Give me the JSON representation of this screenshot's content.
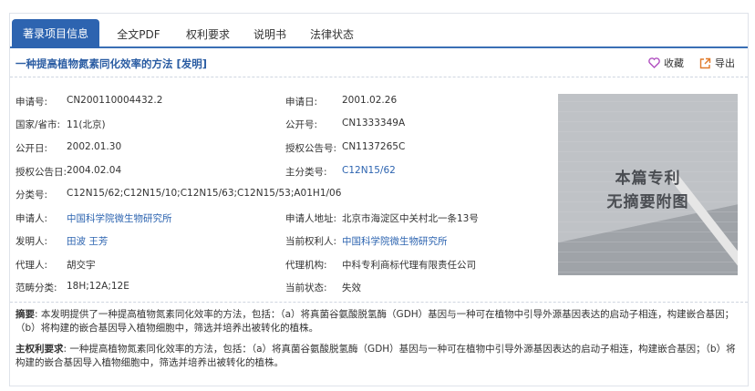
{
  "tabs": [
    {
      "label": "著录项目信息",
      "active": true
    },
    {
      "label": "全文PDF"
    },
    {
      "label": "权利要求"
    },
    {
      "label": "说明书"
    },
    {
      "label": "法律状态"
    }
  ],
  "title": "一种提高植物氮素同化效率的方法 [发明]",
  "actions": {
    "favorite": "收藏",
    "export": "导出"
  },
  "left_fields": [
    {
      "label": "申请号:",
      "value": "CN200110004432.2"
    },
    {
      "label": "国家/省市:",
      "value": "11(北京)"
    },
    {
      "label": "公开日:",
      "value": "2002.01.30"
    },
    {
      "label": "授权公告日:",
      "value": "2004.02.04"
    },
    {
      "label": "分类号:",
      "value": "C12N15/62;C12N15/10;C12N15/63;C12N15/53;A01H1/06"
    },
    {
      "label": "申请人:",
      "value": "中国科学院微生物研究所"
    },
    {
      "label": "发明人:",
      "value": "田波  王芳"
    },
    {
      "label": "代理人:",
      "value": "胡交宇"
    },
    {
      "label": "范畴分类:",
      "value": "18H;12A;12E"
    }
  ],
  "right_fields": [
    {
      "label": "申请日:",
      "value": "2001.02.26"
    },
    {
      "label": "公开号:",
      "value": "CN1333349A"
    },
    {
      "label": "授权公告号:",
      "value": "CN1137265C"
    },
    {
      "label": "主分类号:",
      "value": "C12N15/62"
    },
    {
      "label": "申请人地址:",
      "value": "北京市海淀区中关村北一条13号"
    },
    {
      "label": "当前权利人:",
      "value": "中国科学院微生物研究所"
    },
    {
      "label": "代理机构:",
      "value": "中科专利商标代理有限责任公司"
    },
    {
      "label": "当前状态:",
      "value": "失效"
    }
  ],
  "image_caption": {
    "line1": "本篇专利",
    "line2": "无摘要附图"
  },
  "abstract": {
    "label": "摘要",
    "text": ": 本发明提供了一种提高植物氮素同化效率的方法，包括：（a）将真菌谷氨酸脱氢酶（GDH）基因与一种可在植物中引导外源基因表达的启动子相连，构建嵌合基因；（b）将构建的嵌合基因导入植物细胞中，筛选并培养出被转化的植株。"
  },
  "main_claim": {
    "label": "主权利要求",
    "text": ": 一种提高植物氮素同化效率的方法，包括：（a）将真菌谷氨酸脱氢酶（GDH）基因与一种可在植物中引导外源基因表达的启动子相连，构建嵌合基因；（b）将构建的嵌合基因导入植物细胞中，筛选并培养出被转化的植株。"
  }
}
